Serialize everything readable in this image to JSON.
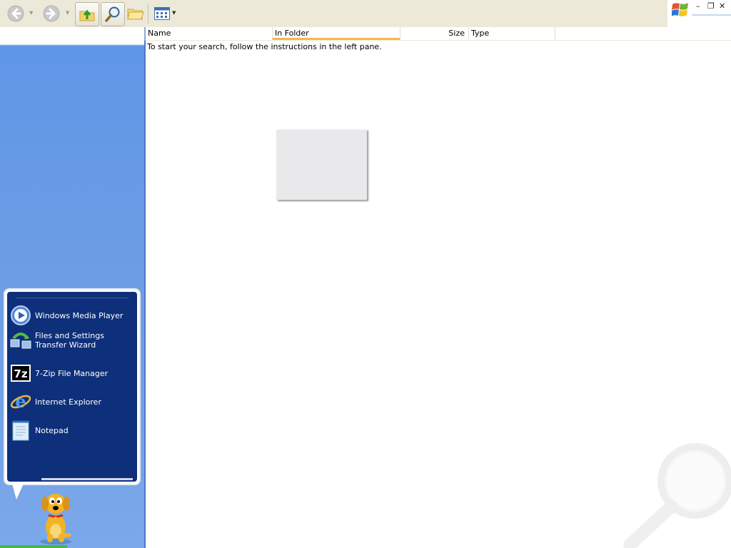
{
  "toolbar": {
    "back": "Back",
    "forward": "Forward",
    "up": "Up",
    "search": "Search",
    "folders": "Folders",
    "views": "Views"
  },
  "results": {
    "columns": [
      "Name",
      "In Folder",
      "Size",
      "Type"
    ],
    "message": "To start your search, follow the instructions in the left pane."
  },
  "balloon": {
    "items": [
      {
        "label": "Windows Media Player",
        "icon": "media-player-icon"
      },
      {
        "label": "Files and Settings Transfer Wizard",
        "icon": "transfer-wizard-icon"
      },
      {
        "label": "7-Zip File Manager",
        "icon": "7zip-icon"
      },
      {
        "label": "Internet Explorer",
        "icon": "ie-icon"
      },
      {
        "label": "Notepad",
        "icon": "notepad-icon"
      }
    ]
  },
  "colors": {
    "pane_blue": "#6f9fe4",
    "balloon_navy": "#0e2f7a",
    "sort_accent": "#f4b84a"
  }
}
